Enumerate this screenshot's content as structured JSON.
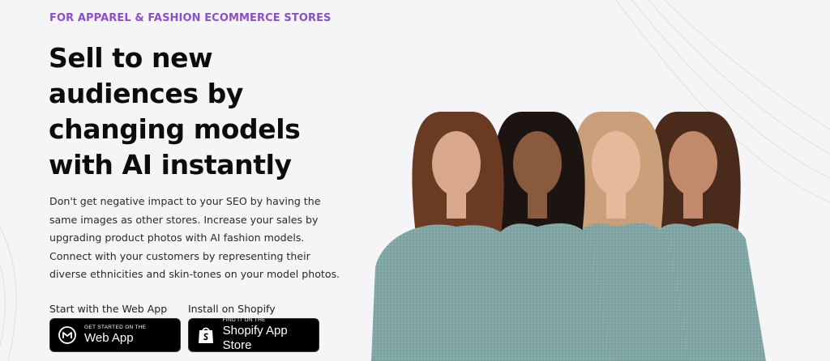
{
  "hero": {
    "eyebrow": "FOR APPAREL & FASHION ECOMMERCE STORES",
    "headline": "Sell to new audiences by changing models with AI instantly",
    "description": "Don't get negative impact to your SEO by having the same images as other stores. Increase your sales by upgrading product photos with AI fashion models. Connect with your customers by representing their diverse ethnicities and skin-tones on your model photos."
  },
  "cta": {
    "web_app": {
      "label": "Start with the Web App",
      "button_small": "GET STARTED ON THE",
      "button_big": "Web App",
      "icon": "m-logo-icon"
    },
    "shopify": {
      "label": "Install on Shopify",
      "button_small": "FIND IT ON THE",
      "button_big": "Shopify App Store",
      "icon": "shopify-bag-icon"
    }
  },
  "colors": {
    "accent": "#8a4fc9",
    "background": "#f5f4f6",
    "headline": "#0c0c0c",
    "button_bg": "#000000",
    "sweater": "#7fa6a4"
  },
  "image": {
    "subject": "four women models wearing the same teal knit sweater",
    "models": [
      {
        "skin": "#d9a789",
        "hair": "#6b3a22"
      },
      {
        "skin": "#8a5a3c",
        "hair": "#1c1410"
      },
      {
        "skin": "#e6b99c",
        "hair": "#c9a07a"
      },
      {
        "skin": "#c2896a",
        "hair": "#4a2a1a"
      }
    ]
  }
}
